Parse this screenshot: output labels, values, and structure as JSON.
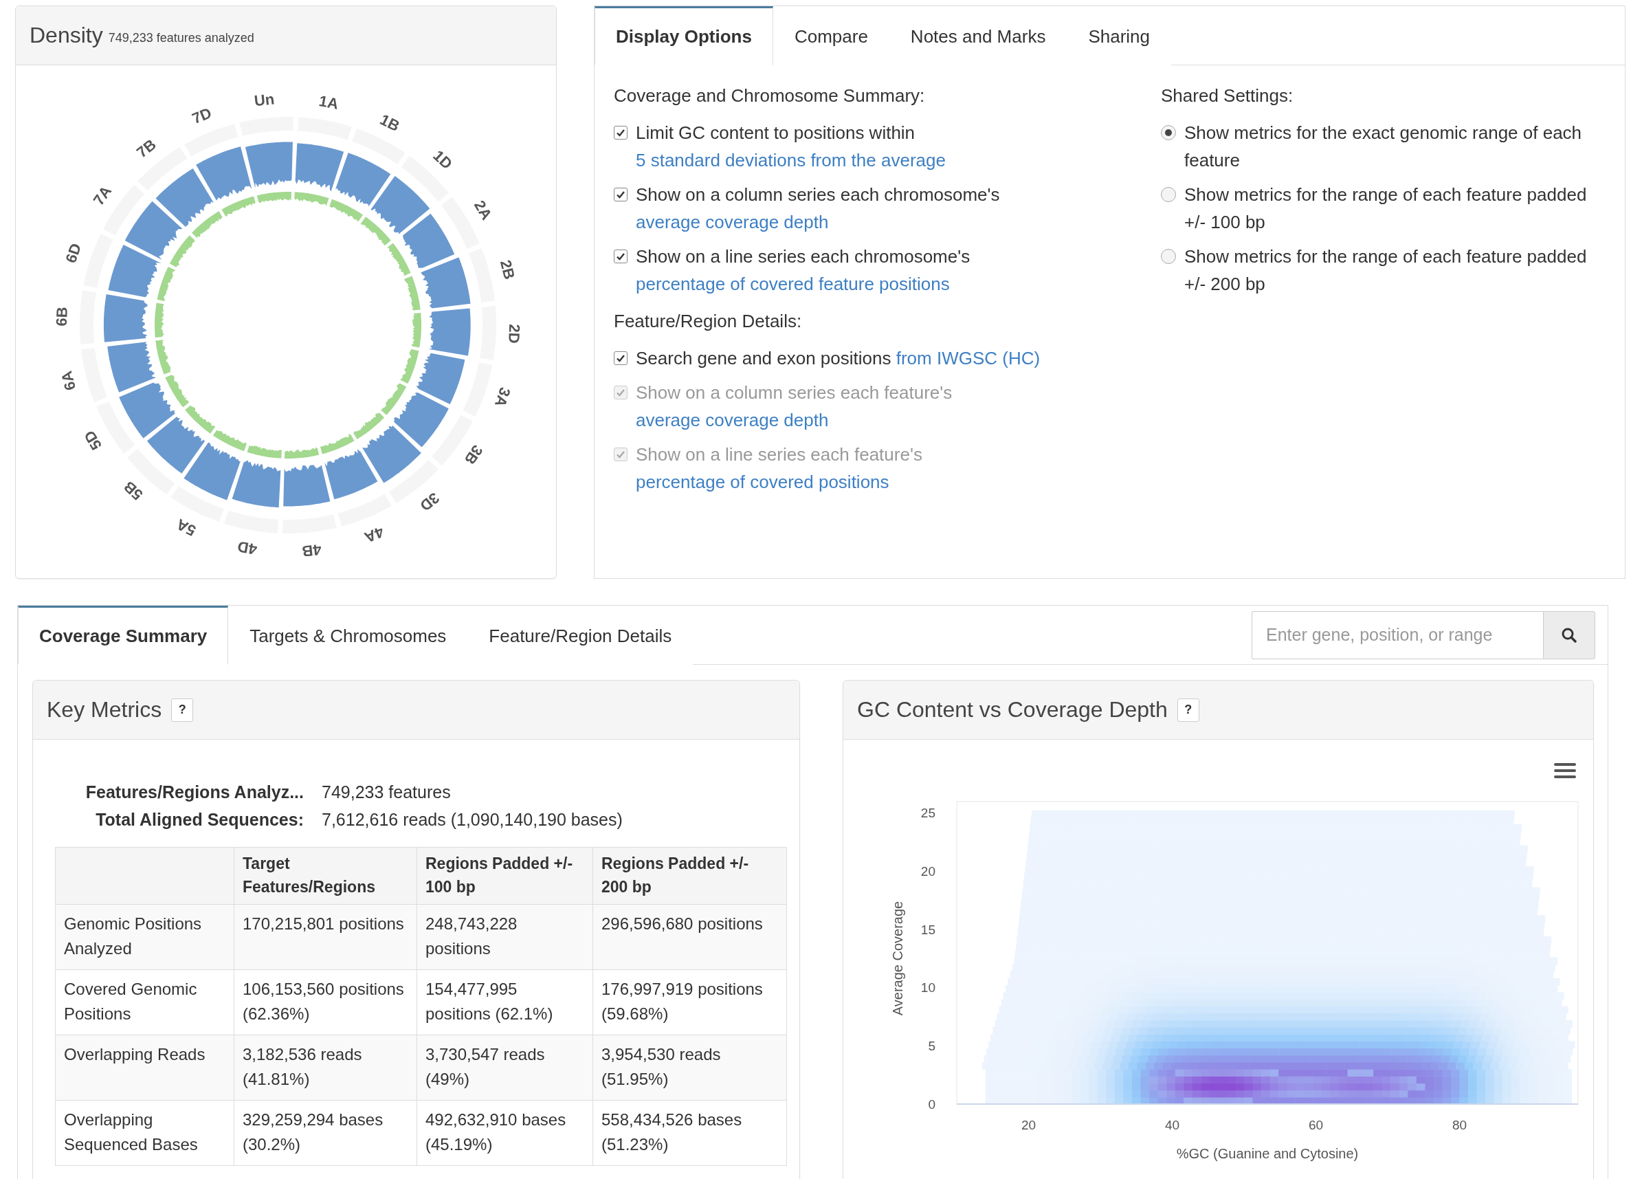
{
  "density_panel": {
    "title": "Density",
    "subtitle": "749,233 features analyzed",
    "chromosomes": [
      "Un",
      "1A",
      "1B",
      "1D",
      "2A",
      "2B",
      "2D",
      "3A",
      "3B",
      "3D",
      "4A",
      "4B",
      "4D",
      "5A",
      "5B",
      "5D",
      "6A",
      "6B",
      "6D",
      "7A",
      "7B",
      "7D"
    ]
  },
  "options_panel": {
    "tabs": [
      {
        "label": "Display Options",
        "selected": true
      },
      {
        "label": "Compare",
        "selected": false
      },
      {
        "label": "Notes and Marks",
        "selected": false
      },
      {
        "label": "Sharing",
        "selected": false
      }
    ],
    "groups": [
      {
        "heading": "Coverage and Chromosome Summary:",
        "options": [
          {
            "checked": true,
            "disabled": false,
            "text": "Limit GC content to positions within ",
            "link": "5 standard deviations from the average"
          },
          {
            "checked": true,
            "disabled": false,
            "text": "Show on a column series each chromosome's ",
            "link": "average coverage depth"
          },
          {
            "checked": true,
            "disabled": false,
            "text": "Show on a line series each chromosome's ",
            "link": "percentage of covered feature positions"
          }
        ]
      },
      {
        "heading": "Feature/Region Details:",
        "options": [
          {
            "checked": true,
            "disabled": false,
            "text": "Search gene and exon positions ",
            "link": "from IWGSC (HC)"
          },
          {
            "checked": true,
            "disabled": true,
            "text": "Show on a column series each feature's ",
            "link": "average coverage depth"
          },
          {
            "checked": true,
            "disabled": true,
            "text": "Show on a line series each feature's ",
            "link": "percentage of covered positions"
          }
        ]
      }
    ],
    "shared": {
      "heading": "Shared Settings:",
      "options": [
        {
          "selected": true,
          "text": "Show metrics for the exact genomic range of each feature"
        },
        {
          "selected": false,
          "text": "Show metrics for the range of each feature padded +/- 100 bp"
        },
        {
          "selected": false,
          "text": "Show metrics for the range of each feature padded +/- 200 bp"
        }
      ]
    }
  },
  "results": {
    "tabs": [
      {
        "label": "Coverage Summary",
        "selected": true
      },
      {
        "label": "Targets & Chromosomes",
        "selected": false
      },
      {
        "label": "Feature/Region Details",
        "selected": false
      }
    ],
    "search": {
      "placeholder": "Enter gene, position, or range"
    },
    "key_metrics": {
      "title": "Key Metrics",
      "help": "?",
      "summary": [
        {
          "label": "Features/Regions Analyz...",
          "value": "749,233 features"
        },
        {
          "label": "Total Aligned Sequences:",
          "value": "7,612,616 reads (1,090,140,190 bases)"
        }
      ],
      "columns": [
        "Target Features/Regions",
        "Regions Padded +/- 100 bp",
        "Regions Padded +/- 200 bp"
      ],
      "rows": [
        {
          "label": "Genomic Positions Analyzed",
          "cells": [
            "170,215,801 positions",
            "248,743,228 positions",
            "296,596,680 positions"
          ]
        },
        {
          "label": "Covered Genomic Positions",
          "cells": [
            "106,153,560 positions (62.36%)",
            "154,477,995 positions (62.1%)",
            "176,997,919 positions (59.68%)"
          ]
        },
        {
          "label": "Overlapping Reads",
          "cells": [
            "3,182,536 reads (41.81%)",
            "3,730,547 reads (49%)",
            "3,954,530 reads (51.95%)"
          ]
        },
        {
          "label": "Overlapping Sequenced Bases",
          "cells": [
            "329,259,294 bases (30.2%)",
            "492,632,910 bases (45.19%)",
            "558,434,526 bases (51.23%)"
          ]
        }
      ]
    },
    "gc_chart": {
      "title": "GC Content vs Coverage Depth",
      "help": "?",
      "y_axis": {
        "title": "Average Coverage",
        "ticks": [
          "25",
          "20",
          "15",
          "10",
          "5",
          "0"
        ]
      },
      "x_axis": {
        "title": "%GC (Guanine and Cytosine)",
        "ticks": [
          "20",
          "40",
          "60",
          "80"
        ]
      }
    }
  }
}
